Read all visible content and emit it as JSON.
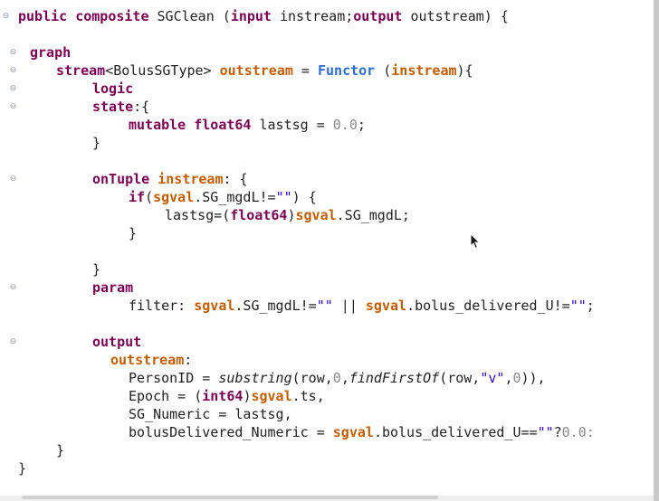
{
  "editor": {
    "lines": [
      {
        "tokens": [
          {
            "t": "public composite",
            "c": "kw"
          },
          {
            "t": " SGClean ("
          },
          {
            "t": "input",
            "c": "kw"
          },
          {
            "t": " instream;"
          },
          {
            "t": "output",
            "c": "kw"
          },
          {
            "t": " outstream) {"
          }
        ]
      },
      {
        "tokens": []
      },
      {
        "tokens": [
          {
            "t": "graph",
            "c": "kw"
          }
        ]
      },
      {
        "tokens": [
          {
            "t": "stream",
            "c": "kw"
          },
          {
            "t": "<BolusSGType> "
          },
          {
            "t": "outstream",
            "c": "var"
          },
          {
            "t": " = "
          },
          {
            "t": "Functor",
            "c": "fn"
          },
          {
            "t": " ("
          },
          {
            "t": "instream",
            "c": "var"
          },
          {
            "t": "){"
          }
        ]
      },
      {
        "tokens": [
          {
            "t": "logic",
            "c": "kw"
          }
        ]
      },
      {
        "tokens": [
          {
            "t": "state",
            "c": "kw"
          },
          {
            "t": ":{"
          }
        ]
      },
      {
        "tokens": [
          {
            "t": "mutable float64",
            "c": "kw"
          },
          {
            "t": " lastsg = "
          },
          {
            "t": "0.0",
            "c": "num"
          },
          {
            "t": ";"
          }
        ]
      },
      {
        "tokens": [
          {
            "t": "}"
          }
        ]
      },
      {
        "tokens": []
      },
      {
        "tokens": [
          {
            "t": "onTuple",
            "c": "kw"
          },
          {
            "t": " "
          },
          {
            "t": "instream",
            "c": "var"
          },
          {
            "t": ": {"
          }
        ]
      },
      {
        "tokens": [
          {
            "t": "if",
            "c": "kw"
          },
          {
            "t": "("
          },
          {
            "t": "sgval",
            "c": "var"
          },
          {
            "t": ".SG_mgdL!="
          },
          {
            "t": "\"\"",
            "c": "str"
          },
          {
            "t": ") {"
          }
        ]
      },
      {
        "tokens": [
          {
            "t": "lastsg=("
          },
          {
            "t": "float64",
            "c": "kw"
          },
          {
            "t": ")"
          },
          {
            "t": "sgval",
            "c": "var"
          },
          {
            "t": ".SG_mgdL;"
          }
        ]
      },
      {
        "tokens": [
          {
            "t": "}"
          }
        ]
      },
      {
        "tokens": []
      },
      {
        "tokens": [
          {
            "t": "}"
          }
        ]
      },
      {
        "tokens": [
          {
            "t": "param",
            "c": "kw"
          }
        ]
      },
      {
        "tokens": [
          {
            "t": "filter: "
          },
          {
            "t": "sgval",
            "c": "var"
          },
          {
            "t": ".SG_mgdL!="
          },
          {
            "t": "\"\"",
            "c": "str"
          },
          {
            "t": " || "
          },
          {
            "t": "sgval",
            "c": "var"
          },
          {
            "t": ".bolus_delivered_U!="
          },
          {
            "t": "\"\"",
            "c": "str"
          },
          {
            "t": ";"
          }
        ]
      },
      {
        "tokens": []
      },
      {
        "tokens": [
          {
            "t": "output",
            "c": "kw"
          }
        ]
      },
      {
        "tokens": [
          {
            "t": "outstream",
            "c": "var"
          },
          {
            "t": ":"
          }
        ]
      },
      {
        "tokens": [
          {
            "t": "PersonID = "
          },
          {
            "t": "substring",
            "c": "it"
          },
          {
            "t": "(row,"
          },
          {
            "t": "0",
            "c": "num"
          },
          {
            "t": ","
          },
          {
            "t": "findFirstOf",
            "c": "it"
          },
          {
            "t": "(row,"
          },
          {
            "t": "\"v\"",
            "c": "str"
          },
          {
            "t": ","
          },
          {
            "t": "0",
            "c": "num"
          },
          {
            "t": ")),"
          }
        ]
      },
      {
        "tokens": [
          {
            "t": "Epoch = ("
          },
          {
            "t": "int64",
            "c": "kw"
          },
          {
            "t": ")"
          },
          {
            "t": "sgval",
            "c": "var"
          },
          {
            "t": ".ts,"
          }
        ]
      },
      {
        "tokens": [
          {
            "t": "SG_Numeric = lastsg,"
          }
        ]
      },
      {
        "tokens": [
          {
            "t": "bolusDelivered_Numeric = "
          },
          {
            "t": "sgval",
            "c": "var"
          },
          {
            "t": ".bolus_delivered_U=="
          },
          {
            "t": "\"\"",
            "c": "str"
          },
          {
            "t": "?"
          },
          {
            "t": "0.0:",
            "c": "num"
          }
        ]
      },
      {
        "tokens": [
          {
            "t": "}"
          }
        ]
      },
      {
        "tokens": [
          {
            "t": "}"
          }
        ]
      }
    ],
    "fold_markers": [
      "collapse-icon",
      "collapse-icon",
      "collapse-icon",
      "collapse-icon",
      "collapse-icon",
      "collapse-icon",
      "collapse-icon",
      "collapse-icon"
    ]
  },
  "colors": {
    "keyword": "#7f0055",
    "variable": "#c95c00",
    "function": "#2a6fd6",
    "number": "#8a8a8a",
    "string": "#2a00ff",
    "fold_marker": "#8a94a6"
  }
}
